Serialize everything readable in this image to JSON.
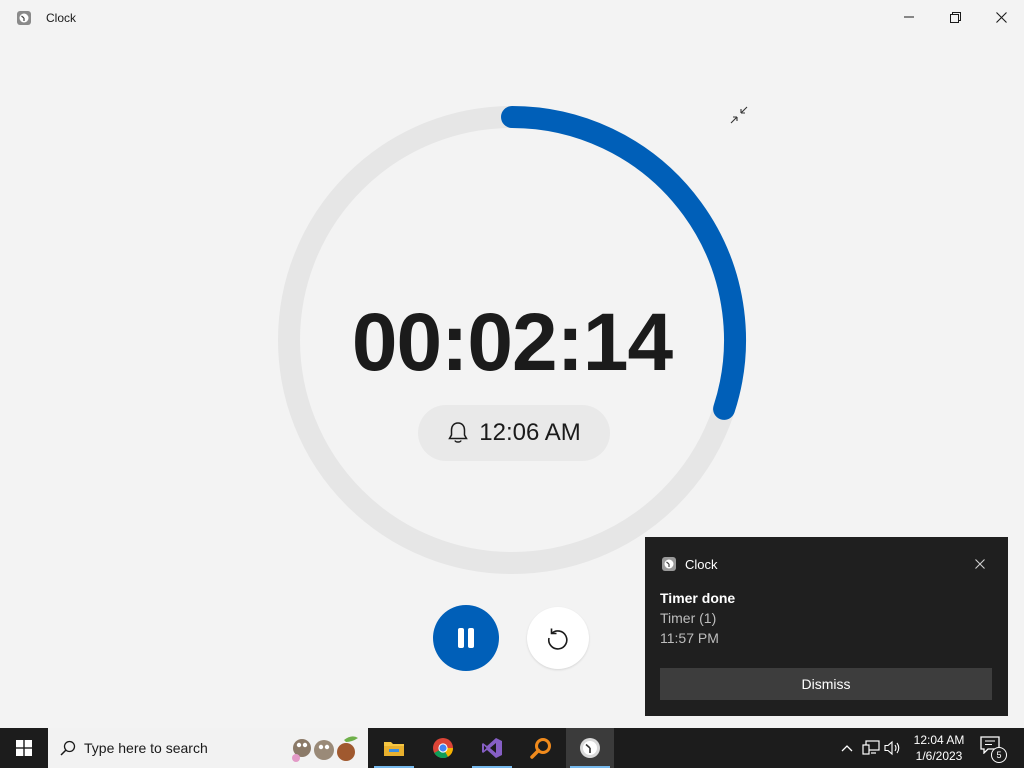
{
  "window": {
    "title": "Clock",
    "minimize_icon": "minimize-icon",
    "maximize_icon": "restore-icon",
    "close_icon": "close-icon"
  },
  "timer": {
    "remaining": "00:02:14",
    "alarm_time": "12:06 AM",
    "progress_fraction": 0.3,
    "accent": "#005fb8",
    "track": "#e6e6e6"
  },
  "controls": {
    "pause_icon": "pause-icon",
    "reset_icon": "reset-icon"
  },
  "toast": {
    "app": "Clock",
    "title": "Timer done",
    "line1": "Timer (1)",
    "line2": "11:57 PM",
    "dismiss": "Dismiss"
  },
  "taskbar": {
    "search_placeholder": "Type here to search",
    "time": "12:04 AM",
    "date": "1/6/2023",
    "notification_count": "5"
  }
}
